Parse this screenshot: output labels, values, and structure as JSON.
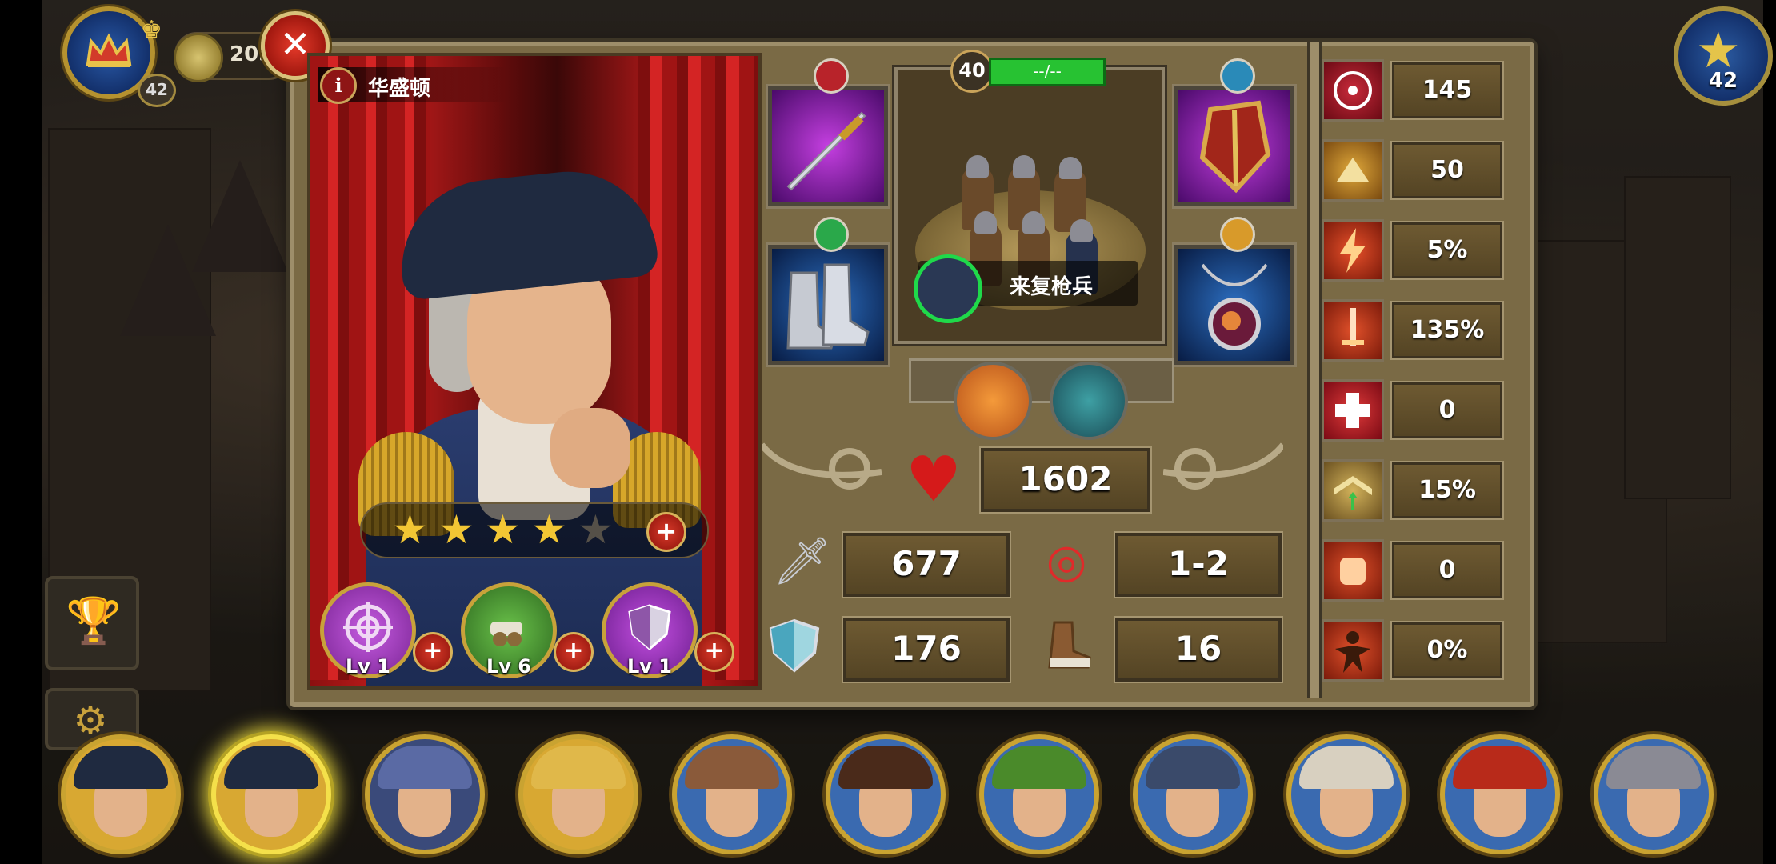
{
  "hud": {
    "player_level": "42",
    "gold_amount": "205",
    "rank_level": "42"
  },
  "hero": {
    "name": "华盛顿",
    "info_icon_label": "i",
    "star_count": 4,
    "max_stars": 5,
    "skills": [
      {
        "level_label": "Lv 1",
        "icon": "target-icon",
        "color": "#9b3bbf"
      },
      {
        "level_label": "Lv 6",
        "icon": "cannon-icon",
        "color": "#3f8a2c"
      },
      {
        "level_label": "Lv 1",
        "icon": "shield-icon",
        "color": "#8a2fb0"
      }
    ]
  },
  "troop": {
    "level": "40",
    "exp_text": "--/--",
    "name": "来复枪兵"
  },
  "equipment": [
    {
      "slot": "weapon",
      "icon": "sword-icon"
    },
    {
      "slot": "armor",
      "icon": "shield-armor-icon"
    },
    {
      "slot": "boots",
      "icon": "boots-icon"
    },
    {
      "slot": "amulet",
      "icon": "amulet-icon"
    }
  ],
  "stats": {
    "hp": "1602",
    "attack": "677",
    "range": "1-2",
    "defense": "176",
    "speed": "16"
  },
  "attributes": [
    {
      "icon": "crosshair-icon",
      "value": "145"
    },
    {
      "icon": "dodge-icon",
      "value": "50"
    },
    {
      "icon": "lightning-icon",
      "value": "5%"
    },
    {
      "icon": "critical-sword-icon",
      "value": "135%"
    },
    {
      "icon": "heal-cross-icon",
      "value": "0"
    },
    {
      "icon": "rank-up-icon",
      "value": "15%"
    },
    {
      "icon": "fist-icon",
      "value": "0"
    },
    {
      "icon": "burning-man-icon",
      "value": "0%"
    }
  ],
  "colors": {
    "panel": "#7a6a45",
    "accent_gold": "#c9a331",
    "exp_green": "#27c232",
    "close_red": "#d0281a"
  }
}
